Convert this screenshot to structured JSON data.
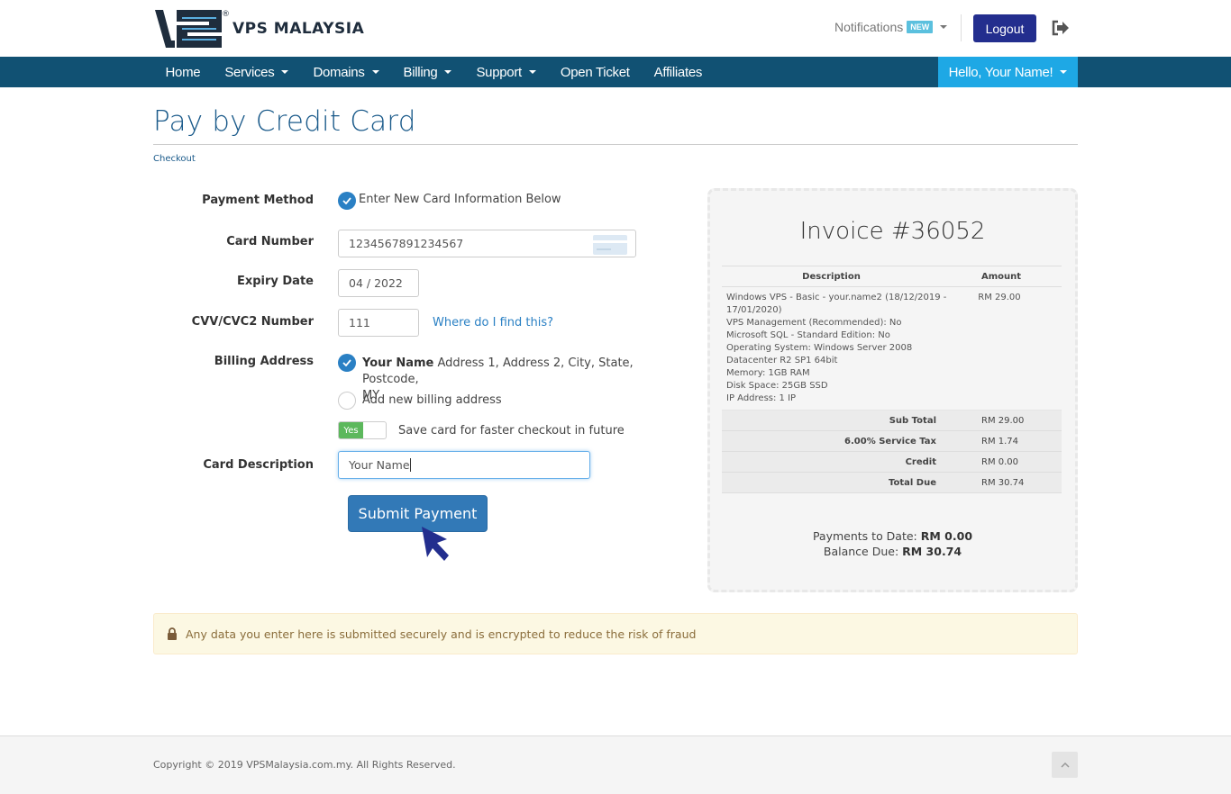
{
  "brand": {
    "name": "VPS MALAYSIA",
    "registered": "®"
  },
  "header": {
    "notifications_label": "Notifications",
    "notifications_badge": "NEW",
    "logout_label": "Logout"
  },
  "nav": {
    "items": [
      {
        "label": "Home",
        "dropdown": false
      },
      {
        "label": "Services",
        "dropdown": true
      },
      {
        "label": "Domains",
        "dropdown": true
      },
      {
        "label": "Billing",
        "dropdown": true
      },
      {
        "label": "Support",
        "dropdown": true
      },
      {
        "label": "Open Ticket",
        "dropdown": false
      },
      {
        "label": "Affiliates",
        "dropdown": false
      }
    ],
    "user_greeting": "Hello, Your Name!"
  },
  "page": {
    "title": "Pay by Credit Card",
    "breadcrumb": "Checkout"
  },
  "form": {
    "payment_method_label": "Payment Method",
    "payment_method_option": "Enter New Card Information Below",
    "card_number_label": "Card Number",
    "card_number_value": "1234567891234567",
    "expiry_label": "Expiry Date",
    "expiry_value": "04 / 2022",
    "cvv_label": "CVV/CVC2 Number",
    "cvv_value": "111",
    "cvv_help_link": "Where do I find this?",
    "billing_label": "Billing Address",
    "billing_name": "Your Name",
    "billing_address": "Address 1, Address 2, City, State, Postcode,",
    "billing_country": "MY",
    "billing_new_option": "Add new billing address",
    "save_card_toggle": "Yes",
    "save_card_text": "Save card for faster checkout in future",
    "card_description_label": "Card Description",
    "card_description_value": "Your Name",
    "submit_label": "Submit Payment"
  },
  "invoice": {
    "title": "Invoice #36052",
    "col_description": "Description",
    "col_amount": "Amount",
    "item_lines": [
      "Windows VPS - Basic - your.name2 (18/12/2019 -",
      "17/01/2020)",
      "VPS Management (Recommended): No",
      "Microsoft SQL - Standard Edition: No",
      "Operating System: Windows Server 2008",
      "Datacenter R2 SP1 64bit",
      "Memory: 1GB RAM",
      "Disk Space: 25GB SSD",
      "IP Address: 1 IP"
    ],
    "item_amount": "RM 29.00",
    "totals": [
      {
        "label": "Sub Total",
        "value": "RM 29.00"
      },
      {
        "label": "6.00% Service Tax",
        "value": "RM 1.74"
      },
      {
        "label": "Credit",
        "value": "RM 0.00"
      },
      {
        "label": "Total Due",
        "value": "RM 30.74"
      }
    ],
    "payments_to_date_label": "Payments to Date:",
    "payments_to_date_value": "RM 0.00",
    "balance_due_label": "Balance Due:",
    "balance_due_value": "RM 30.74"
  },
  "alert": {
    "text": "Any data you enter here is submitted securely and is encrypted to reduce the risk of fraud"
  },
  "footer": {
    "copyright": "Copyright © 2019 VPSMalaysia.com.my. All Rights Reserved."
  },
  "colors": {
    "navbar": "#115173",
    "user_menu": "#1ea8e5",
    "logout": "#232e8e",
    "primary": "#3279b7",
    "title": "#1a5a8a",
    "toggle_on": "#5cb85c",
    "alert_bg": "#fcf8e3"
  }
}
